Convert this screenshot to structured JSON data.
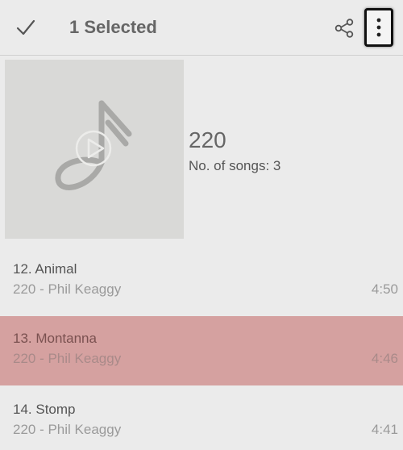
{
  "header": {
    "title": "1 Selected",
    "check_icon": "check-icon",
    "share_icon": "share-icon",
    "more_icon": "more-vert-icon"
  },
  "album": {
    "title": "220",
    "song_count": "No. of songs: 3",
    "art_icon": "music-note-icon"
  },
  "tracks": [
    {
      "title": "12. Animal",
      "subtitle": "220 - Phil Keaggy",
      "duration": "4:50",
      "selected": false
    },
    {
      "title": "13. Montanna",
      "subtitle": "220 - Phil Keaggy",
      "duration": "4:46",
      "selected": true
    },
    {
      "title": "14. Stomp",
      "subtitle": "220 - Phil Keaggy",
      "duration": "4:41",
      "selected": false
    }
  ],
  "colors": {
    "background": "#ebebeb",
    "selected_row": "#d5a1a0",
    "album_art": "#d9d9d7"
  }
}
